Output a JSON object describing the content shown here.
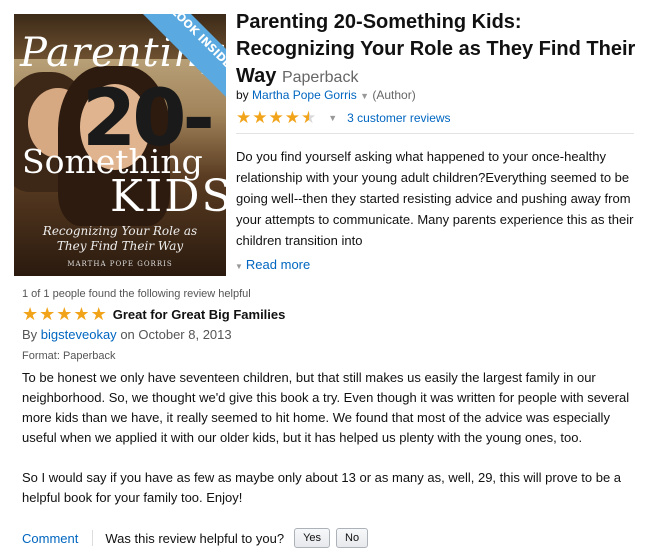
{
  "cover": {
    "ribbon": "LOOK INSIDE",
    "word1": "Parenting",
    "number": "20-",
    "word2": "Something",
    "word3": "KIDS",
    "subtitle": "Recognizing Your Role as They Find Their Way",
    "author": "MARTHA POPE GORRIS"
  },
  "product": {
    "title": "Parenting 20-Something Kids: Recognizing Your Role as They Find Their Way",
    "format": "Paperback",
    "by": "by",
    "author": "Martha Pope Gorris",
    "author_role": "(Author)",
    "rating": 4.5,
    "reviews_link": "3 customer reviews",
    "description": "Do you find yourself asking what happened to your once-healthy relationship with your young adult children?Everything seemed to be going well--then they started resisting advice and pushing away from your attempts to communicate. Many parents experience this as their children transition into",
    "read_more": "Read more"
  },
  "review": {
    "helpful_count": "1 of 1 people found the following review helpful",
    "stars": 5,
    "title": "Great for Great Big Families",
    "by": "By",
    "reviewer": "bigsteveokay",
    "date": "on October 8, 2013",
    "format": "Format: Paperback",
    "paragraph1": "To be honest we only have seventeen children, but that still makes us easily the largest family in our neighborhood. So, we thought we'd give this book a try. Even though it was written for people with several more kids than we have, it really seemed to hit home. We found that most of the advice was especially useful when we applied it with our older kids, but it has helped us plenty with the young ones, too.",
    "paragraph2": "So I would say if you have as few as maybe only about 13 or as many as, well, 29, this will prove to be a helpful book for your family too. Enjoy!",
    "comment": "Comment",
    "helpful_question": "Was this review helpful to you?",
    "yes": "Yes",
    "no": "No"
  },
  "colors": {
    "link": "#0066c0",
    "star": "#f1a41a",
    "ribbon": "#5aa9e0"
  }
}
